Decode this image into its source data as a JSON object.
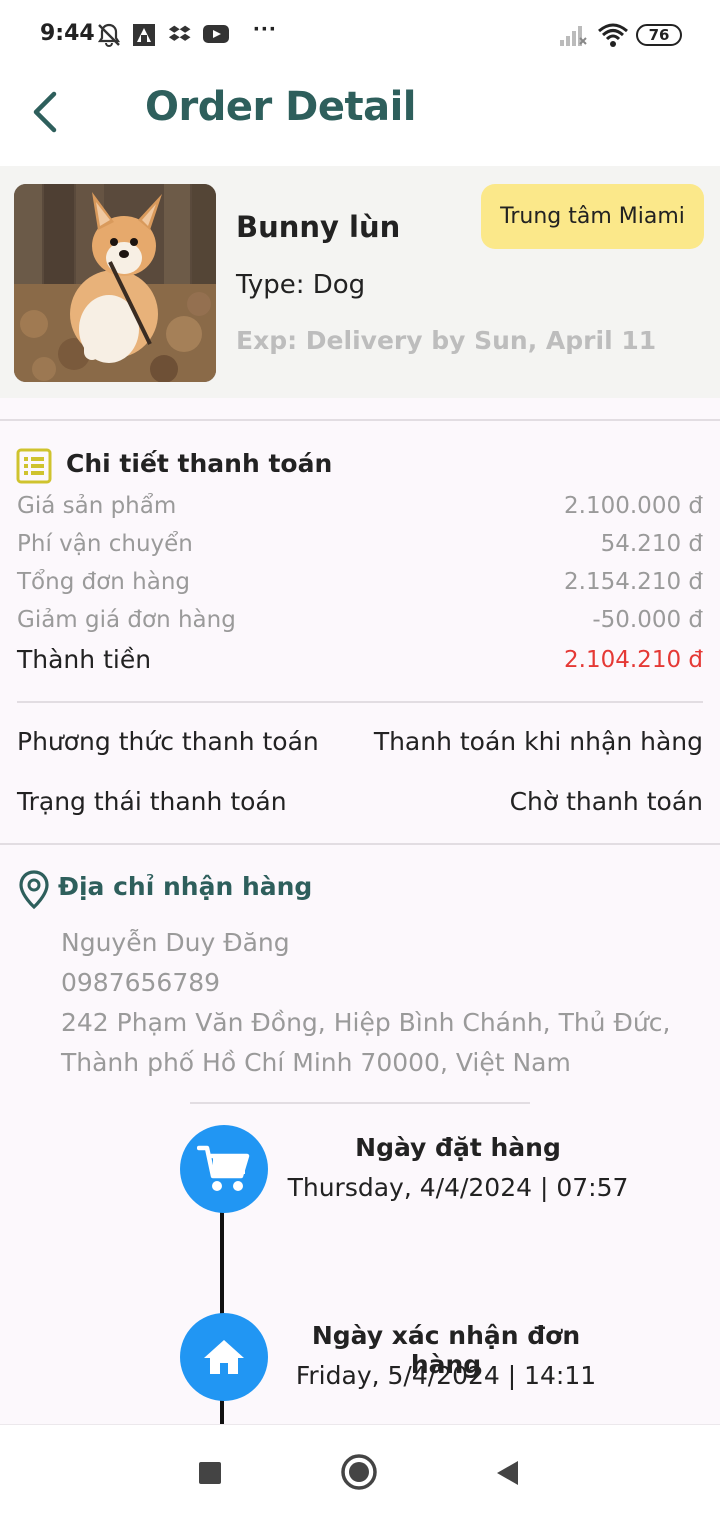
{
  "status_bar": {
    "time": "9:44",
    "more": "···",
    "battery": "76",
    "icons": [
      "mute-icon",
      "app-icon",
      "dropbox-icon",
      "youtube-icon",
      "signal-icon",
      "wifi-icon",
      "battery-icon"
    ]
  },
  "header": {
    "title": "Order Detail",
    "back_icon": "chevron-left-icon"
  },
  "product": {
    "name": "Bunny lùn",
    "type": "Type: Dog",
    "exp": "Exp: Delivery by Sun, April 11",
    "store": "Trung tâm Miami",
    "image": "corgi-puppy-photo"
  },
  "payment": {
    "title": "Chi tiết thanh toán",
    "rows": [
      {
        "label": "Giá sản phẩm",
        "value": "2.100.000 đ"
      },
      {
        "label": "Phí vận chuyển",
        "value": "54.210 đ"
      },
      {
        "label": "Tổng đơn hàng",
        "value": "2.154.210 đ"
      },
      {
        "label": "Giảm giá đơn hàng",
        "value": "-50.000 đ"
      }
    ],
    "total": {
      "label": "Thành tiền",
      "value": "2.104.210 đ"
    },
    "method": {
      "label": "Phương thức thanh toán",
      "value": "Thanh toán khi nhận hàng"
    },
    "status": {
      "label": "Trạng thái thanh toán",
      "value": "Chờ thanh toán"
    }
  },
  "address": {
    "title": "Địa chỉ nhận hàng",
    "name": "Nguyễn Duy Đăng",
    "phone": "0987656789",
    "line1": "242 Phạm Văn Đồng, Hiệp Bình Chánh, Thủ Đức,",
    "line2": "Thành phố Hồ Chí Minh 70000, Việt Nam"
  },
  "timeline": [
    {
      "title": "Ngày đặt hàng",
      "date": "Thursday, 4/4/2024 | 07:57",
      "icon": "cart-icon"
    },
    {
      "title": "Ngày xác nhận đơn hàng",
      "date": "Friday, 5/4/2024 | 14:11",
      "icon": "home-icon"
    }
  ],
  "colors": {
    "brand": "#2e5f5c",
    "badge": "#fbe88a",
    "total_red": "#e53935",
    "timeline_blue": "#2196f3",
    "icon_yellow": "#cfc32e"
  },
  "nav": {
    "icons": [
      "recents-square-icon",
      "home-circle-icon",
      "back-triangle-icon"
    ]
  }
}
